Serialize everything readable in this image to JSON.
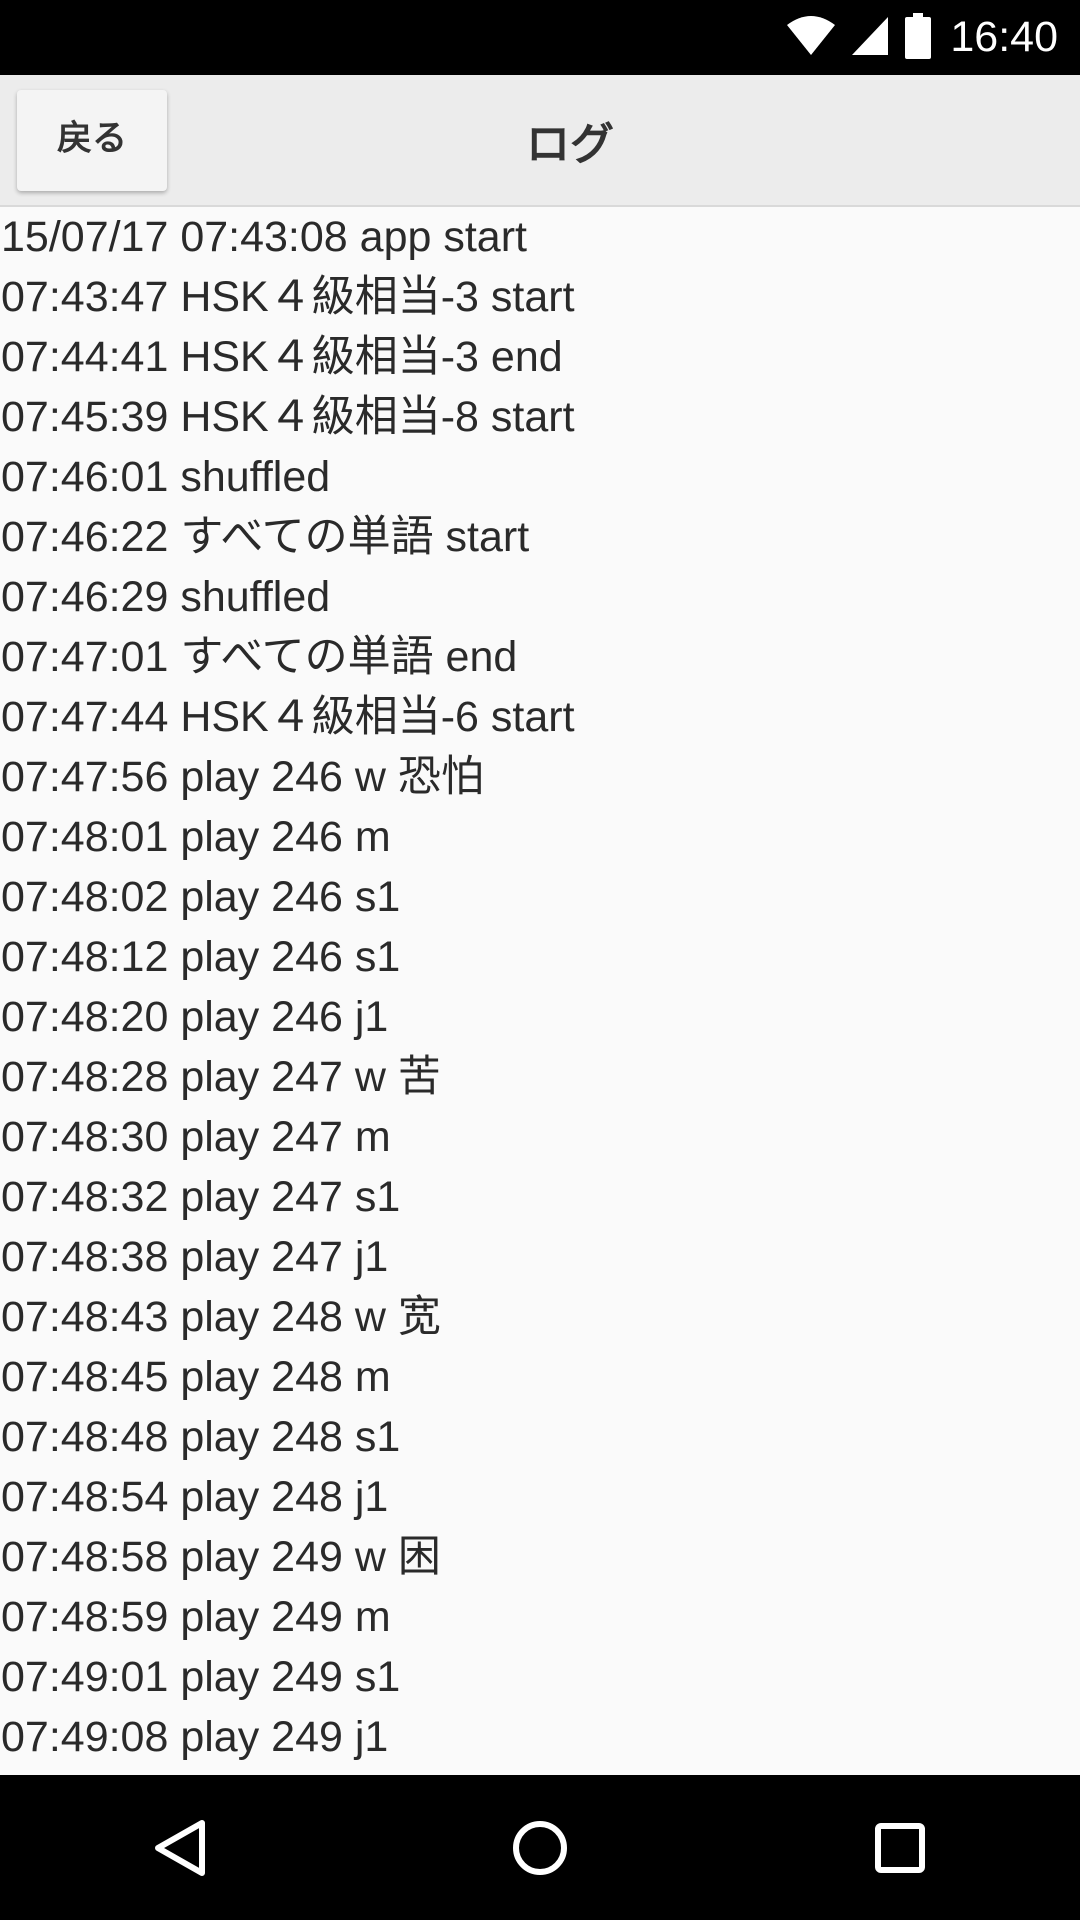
{
  "status_bar": {
    "time": "16:40",
    "icons": [
      "wifi-icon",
      "cell-signal-icon",
      "battery-icon"
    ]
  },
  "app_bar": {
    "back_label": "戻る",
    "title": "ログ"
  },
  "log": {
    "lines": [
      "15/07/17 07:43:08 app start",
      "07:43:47 HSK４級相当-3 start",
      "07:44:41 HSK４級相当-3 end",
      "07:45:39 HSK４級相当-8 start",
      "07:46:01 shuffled",
      "07:46:22 すべての単語 start",
      "07:46:29 shuffled",
      "07:47:01 すべての単語 end",
      "07:47:44 HSK４級相当-6 start",
      "07:47:56 play 246 w 恐怕",
      "07:48:01 play 246 m",
      "07:48:02 play 246 s1",
      "07:48:12 play 246 s1",
      "07:48:20 play 246 j1",
      "07:48:28 play 247 w 苦",
      "07:48:30 play 247 m",
      "07:48:32 play 247 s1",
      "07:48:38 play 247 j1",
      "07:48:43 play 248 w 宽",
      "07:48:45 play 248 m",
      "07:48:48 play 248 s1",
      "07:48:54 play 248 j1",
      "07:48:58 play 249 w 困",
      "07:48:59 play 249 m",
      "07:49:01 play 249 s1",
      "07:49:08 play 249 j1"
    ]
  },
  "nav_bar": {
    "buttons": [
      "back-triangle-icon",
      "home-circle-icon",
      "recents-square-icon"
    ]
  },
  "colors": {
    "status_bar_bg": "#000000",
    "app_bar_bg": "#ececec",
    "content_bg": "#fafafa",
    "text": "#2a2a2a"
  }
}
